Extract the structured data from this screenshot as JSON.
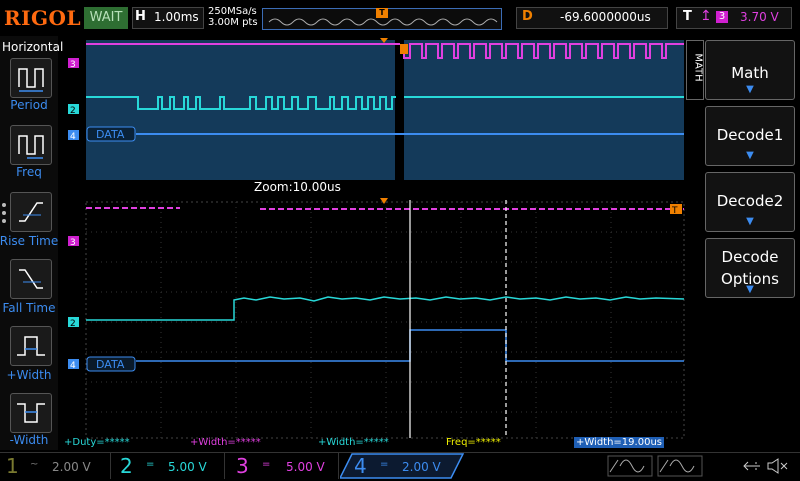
{
  "header": {
    "logo": "RIGOL",
    "run_status": "WAIT",
    "horizontal_label": "H",
    "timebase": "1.00ms",
    "sample_rate": "250MSa/s",
    "memory_depth": "3.00M pts",
    "delay_label": "D",
    "delay_value": "-69.6000000us",
    "trigger_label": "T",
    "trigger_source": "3",
    "trigger_level": "3.70 V",
    "trigger_marker": "T"
  },
  "left_menu": {
    "title": "Horizontal",
    "items": [
      {
        "label": "Period",
        "icon": "period-icon"
      },
      {
        "label": "Freq",
        "icon": "freq-icon"
      },
      {
        "label": "Rise Time",
        "icon": "rise-time-icon"
      },
      {
        "label": "Fall Time",
        "icon": "fall-time-icon"
      },
      {
        "label": "+Width",
        "icon": "positive-width-icon"
      },
      {
        "label": "-Width",
        "icon": "negative-width-icon"
      }
    ]
  },
  "right_menu": {
    "tab": "MATH",
    "items": [
      {
        "label": "Math"
      },
      {
        "label": "Decode1"
      },
      {
        "label": "Decode2"
      },
      {
        "label": "Decode Options",
        "line1": "Decode",
        "line2": "Options"
      }
    ]
  },
  "waveform": {
    "zoom_label": "Zoom:10.00us",
    "ch_markers": [
      "3",
      "2",
      "4"
    ],
    "decode_label": "DATA",
    "trigger_marker_right": "T"
  },
  "measurements": [
    {
      "text": "+Duty=*****",
      "color": "#28d8d8"
    },
    {
      "text": "+Width=*****",
      "color": "#e040e0"
    },
    {
      "text": "+Width=*****",
      "color": "#28d8d8"
    },
    {
      "text": "Freq=*****",
      "color": "#f0f000"
    },
    {
      "text": "+Width=19.00us",
      "color": "#ffffff"
    }
  ],
  "channels": [
    {
      "num": "1",
      "coupling": "~",
      "scale": "2.00 V",
      "color": "#f0f000",
      "active": false
    },
    {
      "num": "2",
      "coupling": "=",
      "scale": "5.00 V",
      "color": "#28d8d8",
      "active": false
    },
    {
      "num": "3",
      "coupling": "=",
      "scale": "5.00 V",
      "color": "#e040e0",
      "active": false
    },
    {
      "num": "4",
      "coupling": "=",
      "scale": "2.00 V",
      "color": "#3c8cf0",
      "active": true
    }
  ],
  "colors": {
    "ch1": "#f0f000",
    "ch2": "#28d8d8",
    "ch3": "#e040e0",
    "ch4": "#3c8cf0",
    "accent": "#f08000"
  }
}
